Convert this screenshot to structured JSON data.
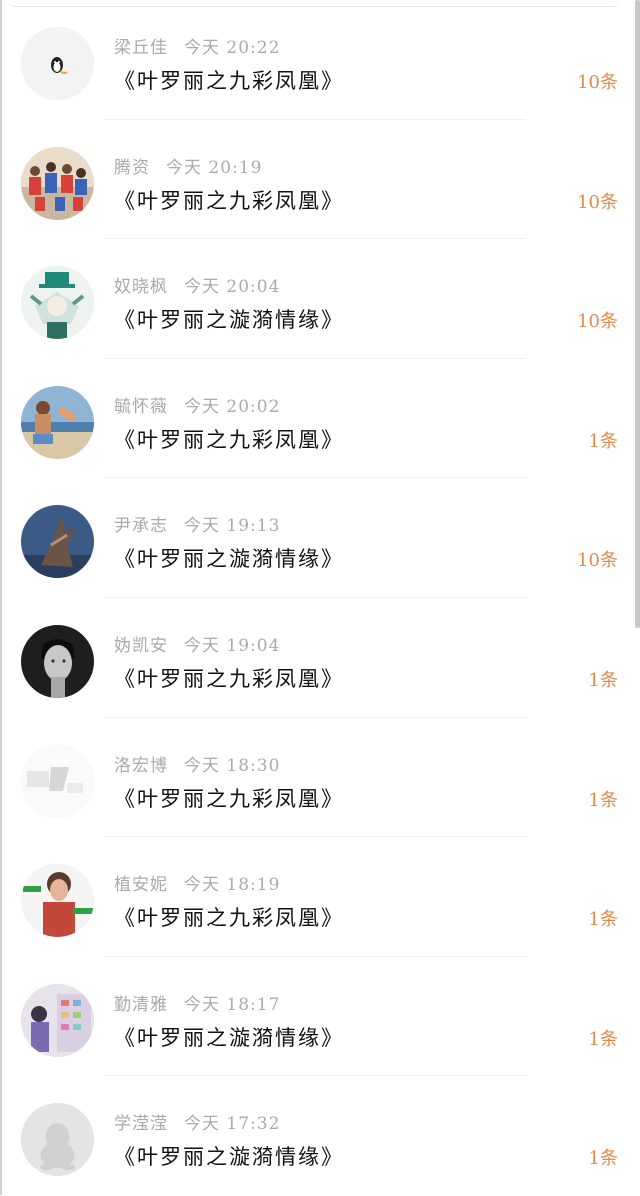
{
  "messages": [
    {
      "name": "梁丘佳",
      "time": "今天 20:22",
      "title": "《叶罗丽之九彩凤凰》",
      "count": "10条",
      "avatar": "penguin-sticker-avatar"
    },
    {
      "name": "腾资",
      "time": "今天 20:19",
      "title": "《叶罗丽之九彩凤凰》",
      "count": "10条",
      "avatar": "group-photo-avatar"
    },
    {
      "name": "奴晓枫",
      "time": "今天 20:04",
      "title": "《叶罗丽之漩漪情缘》",
      "count": "10条",
      "avatar": "anime-character-avatar"
    },
    {
      "name": "毓怀薇",
      "time": "今天 20:02",
      "title": "《叶罗丽之九彩凤凰》",
      "count": "1条",
      "avatar": "beach-photo-avatar"
    },
    {
      "name": "尹承志",
      "time": "今天 19:13",
      "title": "《叶罗丽之漩漪情缘》",
      "count": "10条",
      "avatar": "sculpture-avatar"
    },
    {
      "name": "妫凯安",
      "time": "今天 19:04",
      "title": "《叶罗丽之九彩凤凰》",
      "count": "1条",
      "avatar": "portrait-bw-avatar"
    },
    {
      "name": "洛宏博",
      "time": "今天 18:30",
      "title": "《叶罗丽之九彩凤凰》",
      "count": "1条",
      "avatar": "faded-sketch-avatar"
    },
    {
      "name": "植安妮",
      "time": "今天 18:19",
      "title": "《叶罗丽之九彩凤凰》",
      "count": "1条",
      "avatar": "person-with-text-avatar"
    },
    {
      "name": "勤清雅",
      "time": "今天 18:17",
      "title": "《叶罗丽之漩漪情缘》",
      "count": "1条",
      "avatar": "illustration-shop-avatar"
    },
    {
      "name": "学滢滢",
      "time": "今天 17:32",
      "title": "《叶罗丽之漩漪情缘》",
      "count": "1条",
      "avatar": "default-qq-penguin-avatar"
    }
  ],
  "colors": {
    "count": "#e08a4a",
    "title": "#111111",
    "meta": "#aaaaaa"
  }
}
